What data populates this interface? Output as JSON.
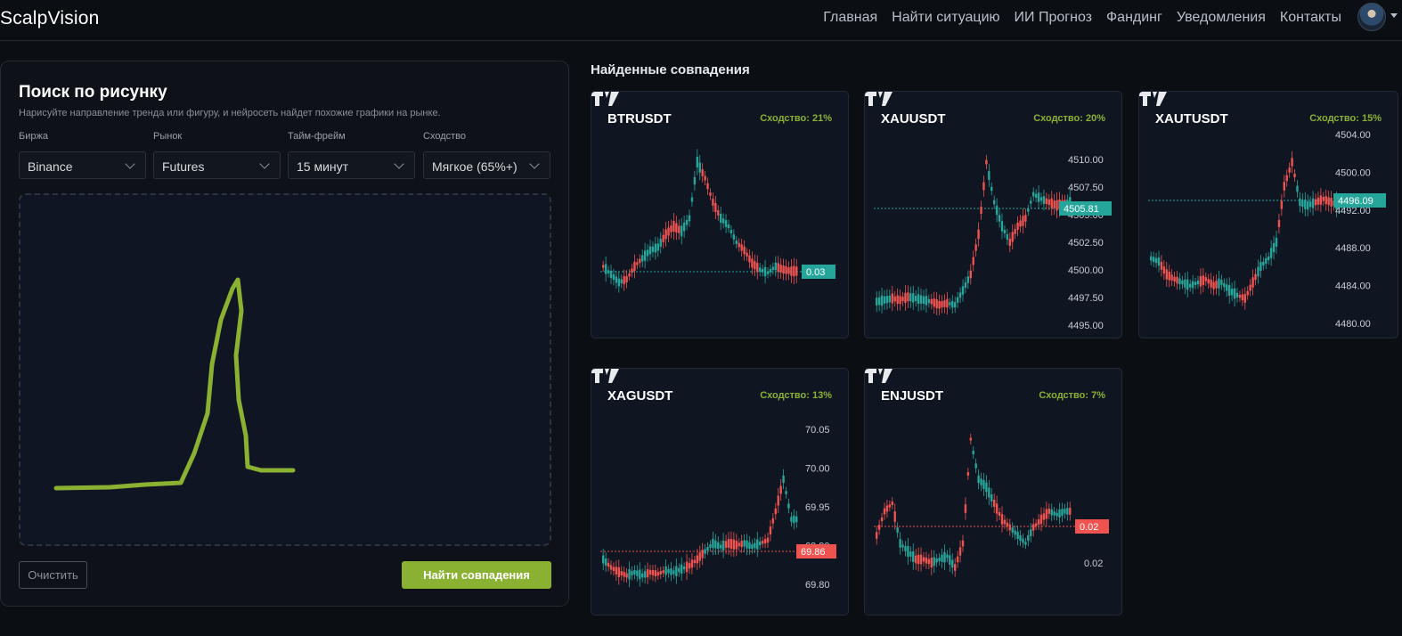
{
  "navbar": {
    "brand": "ScalpVision",
    "links": [
      "Главная",
      "Найти ситуацию",
      "ИИ Прогноз",
      "Фандинг",
      "Уведомления",
      "Контакты"
    ]
  },
  "search": {
    "title": "Поиск по рисунку",
    "subtitle": "Нарисуйте направление тренда или фигуру, и нейросеть найдет похожие графики на рынке.",
    "filters": [
      {
        "label": "Биржа",
        "value": "Binance"
      },
      {
        "label": "Рынок",
        "value": "Futures"
      },
      {
        "label": "Тайм-фрейм",
        "value": "15 минут"
      },
      {
        "label": "Сходство",
        "value": "Мягкое (65%+)"
      }
    ],
    "clear_label": "Очистить",
    "find_label": "Найти совпадения"
  },
  "results": {
    "title": "Найденные совпадения",
    "cards": [
      {
        "symbol": "BTRUSDT",
        "similarity": "Сходство: 21%",
        "price_tag": "0.03",
        "tag_color": "#26a69a",
        "ticks": []
      },
      {
        "symbol": "XAUUSDT",
        "similarity": "Сходство: 20%",
        "price_tag": "4505.81",
        "tag_color": "#26a69a",
        "ticks": [
          "4510.00",
          "4507.50",
          "4505.00",
          "4502.50",
          "4500.00",
          "4497.50",
          "4495.00"
        ]
      },
      {
        "symbol": "XAUTUSDT",
        "similarity": "Сходство: 15%",
        "price_tag": "4496.09",
        "tag_color": "#26a69a",
        "ticks": [
          "4504.00",
          "4500.00",
          "4492.00",
          "4488.00",
          "4484.00",
          "4480.00"
        ]
      },
      {
        "symbol": "XAGUSDT",
        "similarity": "Сходство: 13%",
        "price_tag": "69.86",
        "tag_color": "#ef5350",
        "ticks": [
          "70.05",
          "70.00",
          "69.95",
          "69.90",
          "69.80"
        ]
      },
      {
        "symbol": "ENJUSDT",
        "similarity": "Сходство: 7%",
        "price_tag": "0.02",
        "tag_color": "#ef5350",
        "ticks": [
          "0.02"
        ]
      }
    ]
  },
  "colors": {
    "accent": "#8ab132",
    "up": "#26a69a",
    "down": "#ef5350"
  }
}
